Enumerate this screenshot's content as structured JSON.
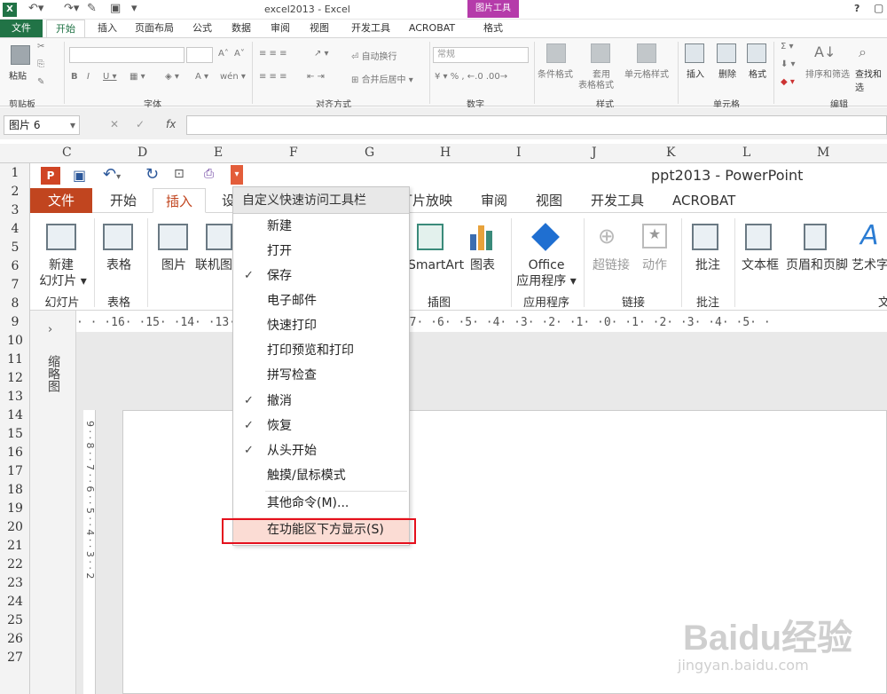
{
  "excel": {
    "title": "excel2013 - Excel",
    "picture_tools": "图片工具",
    "help": "?",
    "tabs": {
      "file": "文件",
      "home": "开始",
      "insert": "插入",
      "layout": "页面布局",
      "formulas": "公式",
      "data": "数据",
      "review": "审阅",
      "view": "视图",
      "developer": "开发工具",
      "acrobat": "ACROBAT",
      "format": "格式"
    },
    "ribbon": {
      "paste": "粘贴",
      "clipboard": "剪贴板",
      "font": "字体",
      "alignment": "对齐方式",
      "wrap_text": "自动换行",
      "merge_center": "合并后居中",
      "number": "数字",
      "number_format": "常规",
      "conditional_format": "条件格式",
      "format_as_table_1": "套用",
      "format_as_table_2": "表格格式",
      "cell_styles": "单元格样式",
      "styles": "样式",
      "insert": "插入",
      "delete": "删除",
      "format": "格式",
      "cells": "单元格",
      "sort_filter": "排序和筛选",
      "find_select": "查找和选",
      "editing": "编辑"
    },
    "name_box": "图片 6",
    "fx": "fx",
    "columns": [
      "C",
      "D",
      "E",
      "F",
      "G",
      "H",
      "I",
      "J",
      "K",
      "L",
      "M"
    ],
    "rows": [
      "1",
      "2",
      "3",
      "4",
      "5",
      "6",
      "7",
      "8",
      "9",
      "10",
      "11",
      "12",
      "13",
      "14",
      "15",
      "16",
      "17",
      "18",
      "19",
      "20",
      "21",
      "22",
      "23",
      "24",
      "25",
      "26",
      "27"
    ]
  },
  "ppt": {
    "title": "ppt2013 - PowerPoint",
    "logo": "P",
    "tabs": {
      "file": "文件",
      "home": "开始",
      "insert": "插入",
      "design": "设",
      "slideshow": "灯片放映",
      "review": "审阅",
      "view": "视图",
      "developer": "开发工具",
      "acrobat": "ACROBAT"
    },
    "ribbon": {
      "new_slide_1": "新建",
      "new_slide_2": "幻灯片",
      "slides": "幻灯片",
      "table": "表格",
      "tables": "表格",
      "picture": "图片",
      "online_pic": "联机图",
      "smartart": "SmartArt",
      "chart": "图表",
      "illustrations": "插图",
      "office_1": "Office",
      "office_2": "应用程序",
      "apps": "应用程序",
      "hyperlink": "超链接",
      "action": "动作",
      "links": "链接",
      "comment_btn": "批注",
      "comments": "批注",
      "textbox": "文本框",
      "header_footer": "页眉和页脚",
      "wordart": "艺术字",
      "text_group": "文"
    },
    "ruler": "· · ·16· ·15· ·14· ·13· ·12· ·11· ·10· ·9· ·8· ·7· ·6· ·5· ·4· ·3· ·2· ·1· ·0· ·1· ·2· ·3· ·4· ·5· ·",
    "vertical_ruler": "9 · · 8 · · 7 · · 6 · · 5 · · 4 · · 3 · · 2",
    "thumbnails": "缩略图"
  },
  "menu": {
    "header": "自定义快速访问工具栏",
    "items": [
      {
        "label": "新建",
        "checked": ""
      },
      {
        "label": "打开",
        "checked": ""
      },
      {
        "label": "保存",
        "checked": "✓"
      },
      {
        "label": "电子邮件",
        "checked": ""
      },
      {
        "label": "快速打印",
        "checked": ""
      },
      {
        "label": "打印预览和打印",
        "checked": ""
      },
      {
        "label": "拼写检查",
        "checked": ""
      },
      {
        "label": "撤消",
        "checked": "✓"
      },
      {
        "label": "恢复",
        "checked": "✓"
      },
      {
        "label": "从头开始",
        "checked": "✓"
      },
      {
        "label": "触摸/鼠标模式",
        "checked": ""
      },
      {
        "label": "其他命令(M)...",
        "checked": ""
      },
      {
        "label": "在功能区下方显示(S)",
        "checked": ""
      }
    ]
  },
  "watermark": {
    "logo": "Baidu经验",
    "url": "jingyan.baidu.com"
  }
}
